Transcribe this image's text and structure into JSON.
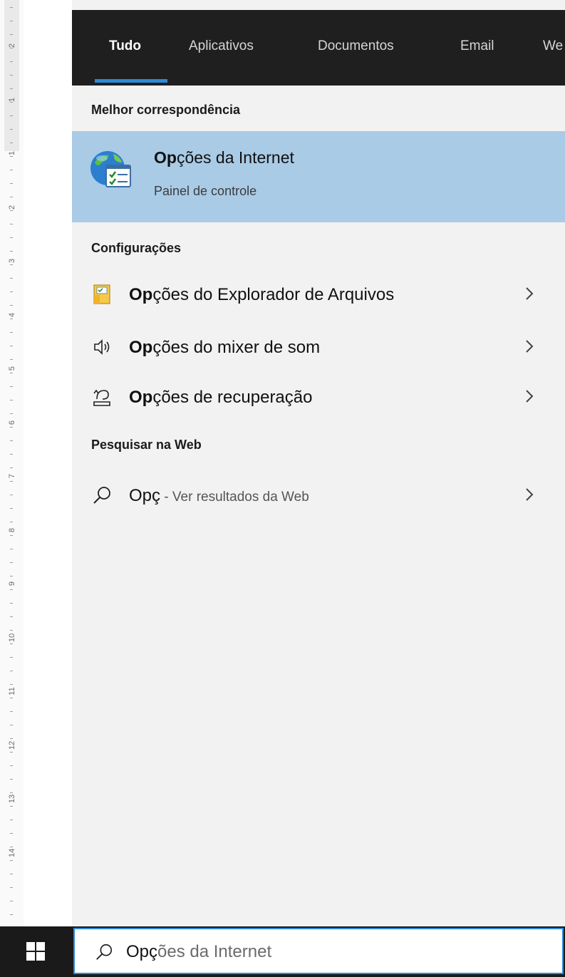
{
  "ruler": {
    "numbers": [
      "2",
      "1",
      "1",
      "2",
      "3",
      "4",
      "5",
      "6",
      "7",
      "8",
      "9",
      "10",
      "11",
      "12",
      "13",
      "14"
    ]
  },
  "tabs": [
    "Tudo",
    "Aplicativos",
    "Documentos",
    "Email",
    "We"
  ],
  "best_match": {
    "section_label": "Melhor correspondência",
    "title_bold": "Op",
    "title_rest": "ções da Internet",
    "subtitle": "Painel de controle",
    "icon": "internet-options-globe-icon"
  },
  "settings": {
    "section_label": "Configurações",
    "items": [
      {
        "bold": "Op",
        "rest": "ções do Explorador de Arquivos",
        "icon": "folder-options-icon"
      },
      {
        "bold": "Op",
        "rest": "ções do mixer de som",
        "icon": "speaker-icon"
      },
      {
        "bold": "Op",
        "rest": "ções de recuperação",
        "icon": "recovery-icon"
      }
    ]
  },
  "web": {
    "section_label": "Pesquisar na Web",
    "query": "Opç",
    "suffix": " - Ver resultados da Web",
    "icon": "search-icon"
  },
  "taskbar": {
    "search_typed": "Opç",
    "search_rest": "ões da Internet",
    "start_icon": "windows-logo-icon"
  },
  "colors": {
    "accent": "#2d8ad8",
    "selected_bg": "#a9cbe6",
    "tabbar_bg": "#1f1f1f",
    "panel_bg": "#f2f2f2"
  }
}
